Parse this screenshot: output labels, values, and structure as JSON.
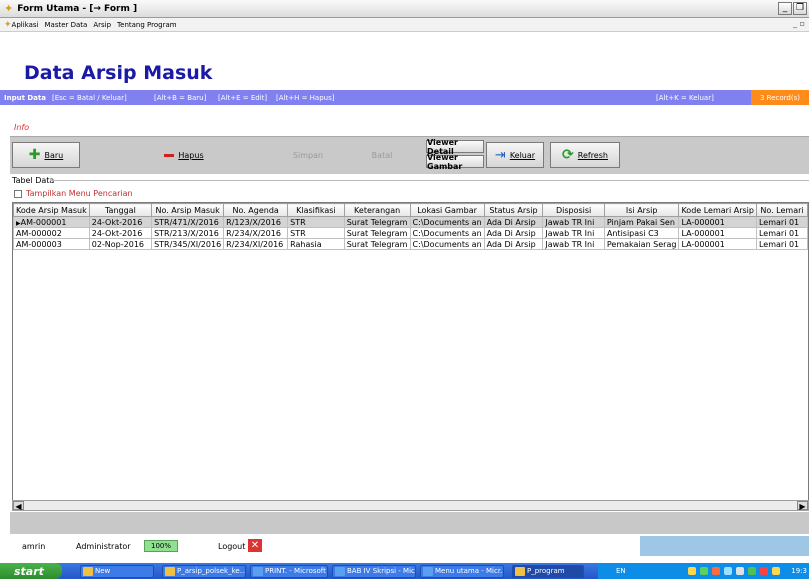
{
  "window": {
    "title": "Form Utama  - [→ Form ]"
  },
  "menu": [
    "Aplikasi",
    "Master Data",
    "Arsip",
    "Tentang Program"
  ],
  "header": {
    "title": "Data Arsip Masuk"
  },
  "shortcuts": {
    "label": "Input Data",
    "esc": "[Esc = Batal / Keluar]",
    "baru": "[Alt+B = Baru]",
    "edit": "[Alt+E = Edit]",
    "hapus": "[Alt+H = Hapus]",
    "keluar": "[Alt+K = Keluar]",
    "records": "3 Record(s)"
  },
  "info": "Info",
  "toolbar": {
    "baru": "Baru",
    "hapus": "Hapus",
    "simpan": "Simpan",
    "batal": "Batal",
    "viewer_detail": "Viewer Detail",
    "viewer_gambar": "Viewer Gambar",
    "keluar": "Keluar",
    "refresh": "Refresh"
  },
  "table_label": "Tabel Data",
  "search_toggle": "Tampilkan Menu Pencarian",
  "columns": [
    "Kode Arsip Masuk",
    "Tanggal",
    "No. Arsip Masuk",
    "No. Agenda",
    "Klasifikasi",
    "Keterangan",
    "Lokasi Gambar",
    "Status Arsip",
    "Disposisi",
    "Isi Arsip",
    "Kode Lemari Arsip",
    "No. Lemari"
  ],
  "rows": [
    [
      "AM-000001",
      "24-Okt-2016",
      "STR/471/X/2016",
      "R/123/X/2016",
      "STR",
      "Surat Telegram",
      "C:\\Documents an",
      "Ada Di Arsip",
      "Jawab TR Ini",
      "Pinjam Pakai Sen",
      "LA-000001",
      "Lemari 01"
    ],
    [
      "AM-000002",
      "24-Okt-2016",
      "STR/213/X/2016",
      "R/234/X/2016",
      "STR",
      "Surat Telegram",
      "C:\\Documents an",
      "Ada Di Arsip",
      "Jawab TR Ini",
      "Antisipasi C3",
      "LA-000001",
      "Lemari 01"
    ],
    [
      "AM-000003",
      "02-Nop-2016",
      "STR/345/XI/2016",
      "R/234/XI/2016",
      "Rahasia",
      "Surat Telegram",
      "C:\\Documents an",
      "Ada Di Arsip",
      "Jawab TR Ini",
      "Pemakaian Serag",
      "LA-000001",
      "Lemari 01"
    ]
  ],
  "status": {
    "user": "amrin",
    "role": "Administrator",
    "zoom": "100%",
    "logout": "Logout"
  },
  "taskbar": {
    "start": "start",
    "items": [
      "New",
      "P_arsip_polsek_ke...",
      "PRINT. - Microsoft ...",
      "BAB IV Skripsi - Mic...",
      "Menu utama - Micr...",
      "P_program"
    ],
    "lang": "EN",
    "clock": "19:3"
  }
}
